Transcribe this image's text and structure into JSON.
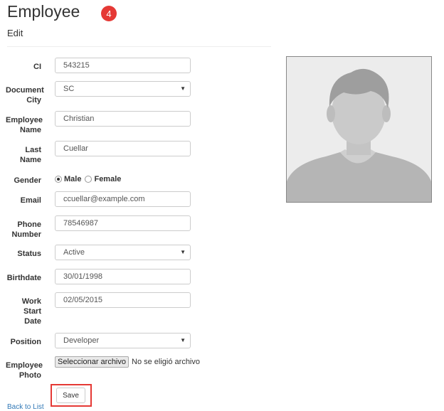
{
  "header": {
    "title": "Employee",
    "step_badge": "4",
    "subtitle": "Edit"
  },
  "form": {
    "ci": {
      "label": "CI",
      "value": "543215"
    },
    "document_city": {
      "label": "Document City",
      "value": "SC"
    },
    "employee_name": {
      "label": "Employee Name",
      "value": "Christian"
    },
    "last_name": {
      "label": "Last Name",
      "value": "Cuellar"
    },
    "gender": {
      "label": "Gender",
      "options": [
        "Male",
        "Female"
      ],
      "selected": "Male"
    },
    "email": {
      "label": "Email",
      "value": "ccuellar@example.com"
    },
    "phone": {
      "label": "Phone Number",
      "value": "78546987"
    },
    "status": {
      "label": "Status",
      "value": "Active"
    },
    "birthdate": {
      "label": "Birthdate",
      "value": "30/01/1998"
    },
    "work_start": {
      "label": "Work Start Date",
      "value": "02/05/2015"
    },
    "position": {
      "label": "Position",
      "value": "Developer"
    },
    "photo": {
      "label": "Employee Photo",
      "button": "Seleccionar archivo",
      "status": "No se eligió archivo"
    },
    "save_label": "Save"
  },
  "back_link": "Back to List",
  "colors": {
    "accent_red": "#e53935",
    "link": "#337ab7",
    "avatar_bg": "#ececec",
    "avatar_fg": "#bdbdbd",
    "hair": "#9e9e9e"
  }
}
